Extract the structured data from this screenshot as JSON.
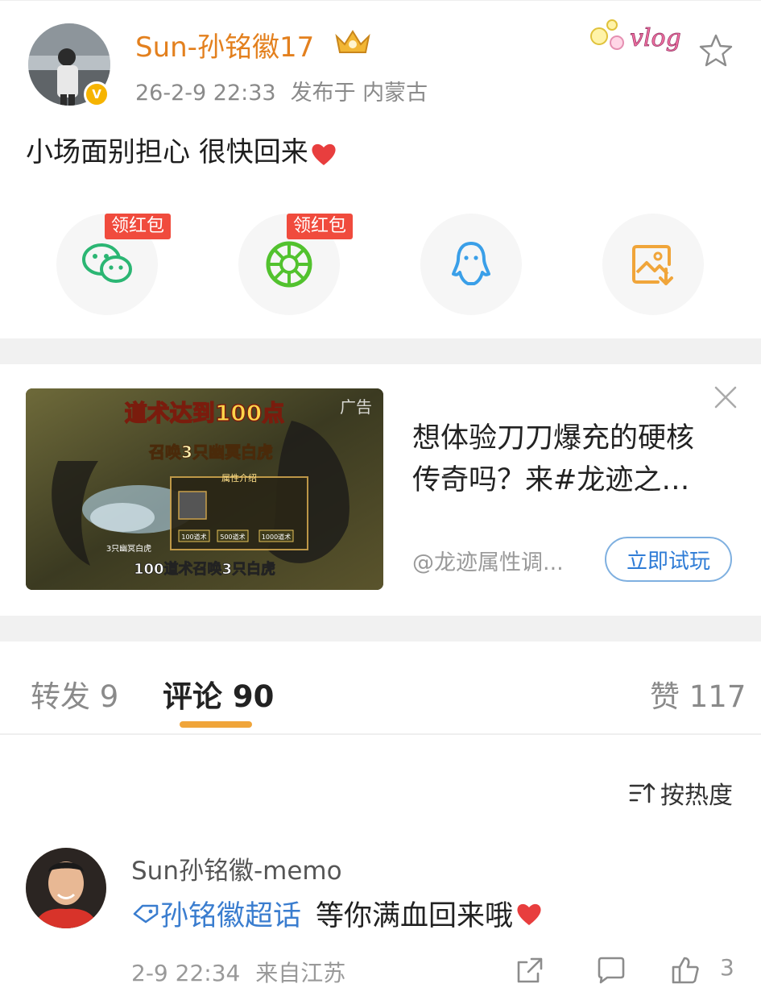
{
  "post": {
    "username": "Sun-孙铭徽17",
    "time": "26-2-9 22:33",
    "location": "发布于 内蒙古",
    "badge_text": "vlog",
    "content": "小场面别担心 很快回来"
  },
  "share": {
    "items": [
      {
        "icon": "wechat-icon",
        "tag": "领红包",
        "color": "#2bb673"
      },
      {
        "icon": "moments-icon",
        "tag": "领红包",
        "color": "#52c22e"
      },
      {
        "icon": "qq-icon",
        "tag": "",
        "color": "#3a9fe8"
      },
      {
        "icon": "save-image-icon",
        "tag": "",
        "color": "#f0a53a"
      }
    ]
  },
  "ad": {
    "label": "广告",
    "image_title": "道术达到100点",
    "image_subtitle": "召唤3只幽冥白虎",
    "image_panel_title": "属性介绍",
    "image_options": [
      "100道术",
      "500道术",
      "1000道术"
    ],
    "image_caption_small": "3只幽冥白虎",
    "image_caption": "100道术召唤3只白虎",
    "text_line1": "想体验刀刀爆充的硬核",
    "text_line2": "传奇吗？来#龙迹之…",
    "source": "@龙迹属性调...",
    "button": "立即试玩"
  },
  "tabs": {
    "repost": "转发 9",
    "comments": "评论 90",
    "likes": "赞 117"
  },
  "sort": {
    "label": "按热度"
  },
  "comment": {
    "name": "Sun孙铭徽-memo",
    "topic": "孙铭徽超话",
    "text": "等你满血回来哦",
    "time": "2-9 22:34",
    "location": "来自江苏",
    "reply_count": "3"
  },
  "colors": {
    "username": "#e3801e",
    "link": "#3a7dcf",
    "accent": "#f0a53a",
    "red_tag": "#f04b3d"
  }
}
